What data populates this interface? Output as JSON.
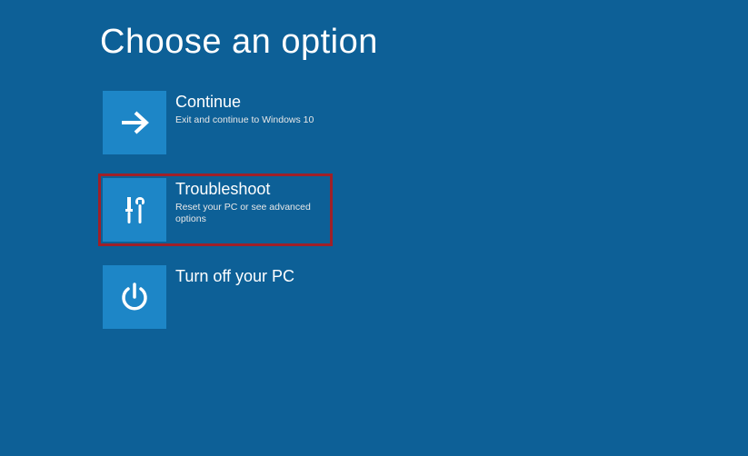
{
  "colors": {
    "background": "#0d6097",
    "tile": "#1d86c7",
    "highlight": "#a02028",
    "text": "#ffffff"
  },
  "title": "Choose an option",
  "options": {
    "continue": {
      "title": "Continue",
      "desc": "Exit and continue to Windows 10"
    },
    "troubleshoot": {
      "title": "Troubleshoot",
      "desc": "Reset your PC or see advanced options"
    },
    "turnoff": {
      "title": "Turn off your PC",
      "desc": ""
    }
  }
}
